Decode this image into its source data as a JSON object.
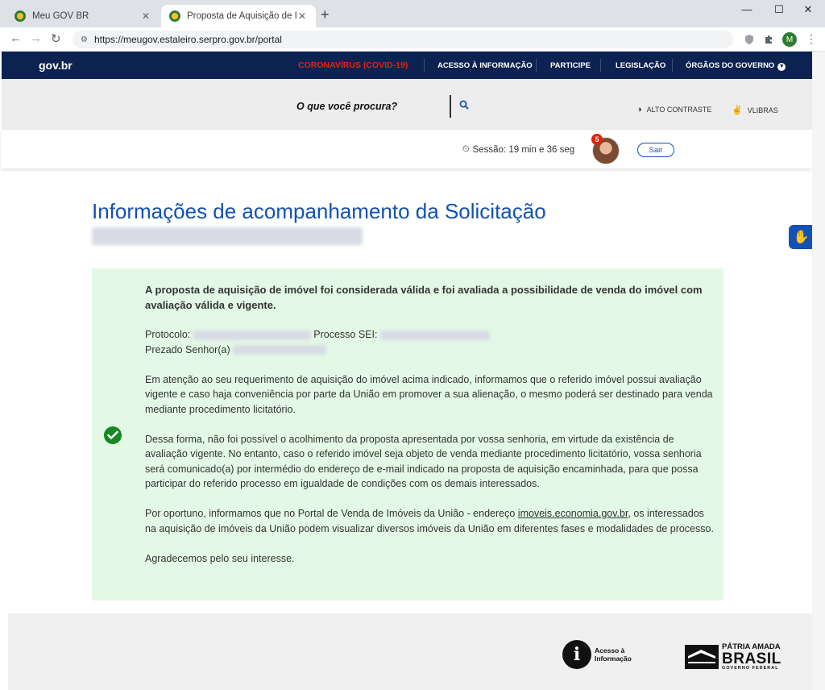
{
  "browser": {
    "tabs": [
      {
        "title": "Meu GOV BR",
        "active": false
      },
      {
        "title": "Proposta de Aquisição de Imóvel",
        "active": true
      }
    ],
    "url": "https://meugov.estaleiro.serpro.gov.br/portal",
    "profile_initial": "M",
    "icons": {
      "back": "arrow-left-icon",
      "forward": "arrow-right-icon",
      "reload": "reload-icon",
      "new_tab": "plus-icon",
      "extensions": "puzzle-icon",
      "menu": "kebab-menu-icon"
    }
  },
  "gov_nav": {
    "logo": "gov.br",
    "covid": "CORONAVÍRUS (COVID-19)",
    "items": [
      "ACESSO À INFORMAÇÃO",
      "PARTICIPE",
      "LEGISLAÇÃO",
      "ÓRGÃOS DO GOVERNO"
    ]
  },
  "search": {
    "prompt": "O que você procura?",
    "high_contrast": "ALTO CONTRASTE",
    "vlibras": "VLIBRAS"
  },
  "session": {
    "label": "Sessão: 19 min e 36 seg",
    "notification_count": "5",
    "logout": "Sair"
  },
  "main": {
    "title": "Informações de acompanhamento da Solicitação",
    "panel": {
      "headline": "A proposta de aquisição de imóvel foi considerada válida e foi avaliada a possibilidade de venda do imóvel com avaliação válida e vigente.",
      "protocolo_label": "Protocolo:",
      "processo_label": "Processo SEI:",
      "prezado": "Prezado Senhor(a)",
      "p1": "Em atenção ao seu requerimento de aquisição do imóvel acima indicado, informamos que o referido imóvel possui avaliação vigente e caso haja conveniência por parte da União em promover a sua alienação, o mesmo poderá ser destinado para venda mediante procedimento licitatório.",
      "p2": "Dessa forma, não foi possível o acolhimento da proposta apresentada por vossa senhoria, em virtude da existência de avaliação vigente. No entanto, caso o referido imóvel seja objeto de venda mediante procedimento licitatório, vossa senhoria será comunicado(a) por intermédio do endereço de e-mail indicado na proposta de aquisição encaminhada, para que possa participar do referido processo em igualdade de condições com os demais interessados.",
      "p3_before": "Por oportuno, informamos que no Portal de Venda de Imóveis da União - endereço",
      "p3_link": "imoveis.economia.gov.br",
      "p3_after": ", os interessados na aquisição de imóveis da União podem visualizar diversos imóveis da União em diferentes fases e modalidades de processo.",
      "closing": "Agradecemos pelo seu interesse."
    }
  },
  "footer": {
    "lai_letter": "i",
    "lai_line1": "Acesso à",
    "lai_line2": "Informação",
    "patria": "PÁTRIA AMADA",
    "brasil": "BRASIL",
    "gov": "GOVERNO FEDERAL"
  },
  "colors": {
    "nav_bg": "#0c2250",
    "covid": "#e52207",
    "primary": "#1351b4",
    "panel_bg": "#e3f9e5",
    "success": "#168821"
  }
}
